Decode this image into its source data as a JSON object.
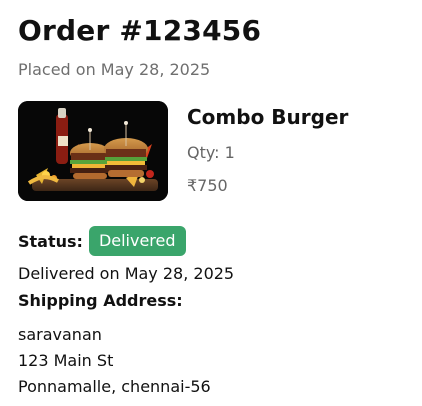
{
  "order": {
    "title": "Order #123456",
    "placed_on": "Placed on May 28, 2025"
  },
  "item": {
    "name": "Combo Burger",
    "qty": "Qty: 1",
    "price": "₹750"
  },
  "status": {
    "label": "Status:",
    "value": "Delivered",
    "badge_color": "#3aa56b"
  },
  "delivery": {
    "delivered_on": "Delivered on May 28, 2025"
  },
  "shipping": {
    "label": "Shipping Address:",
    "lines": [
      "saravanan",
      "123 Main St",
      "Ponnamalle, chennai-56"
    ]
  }
}
